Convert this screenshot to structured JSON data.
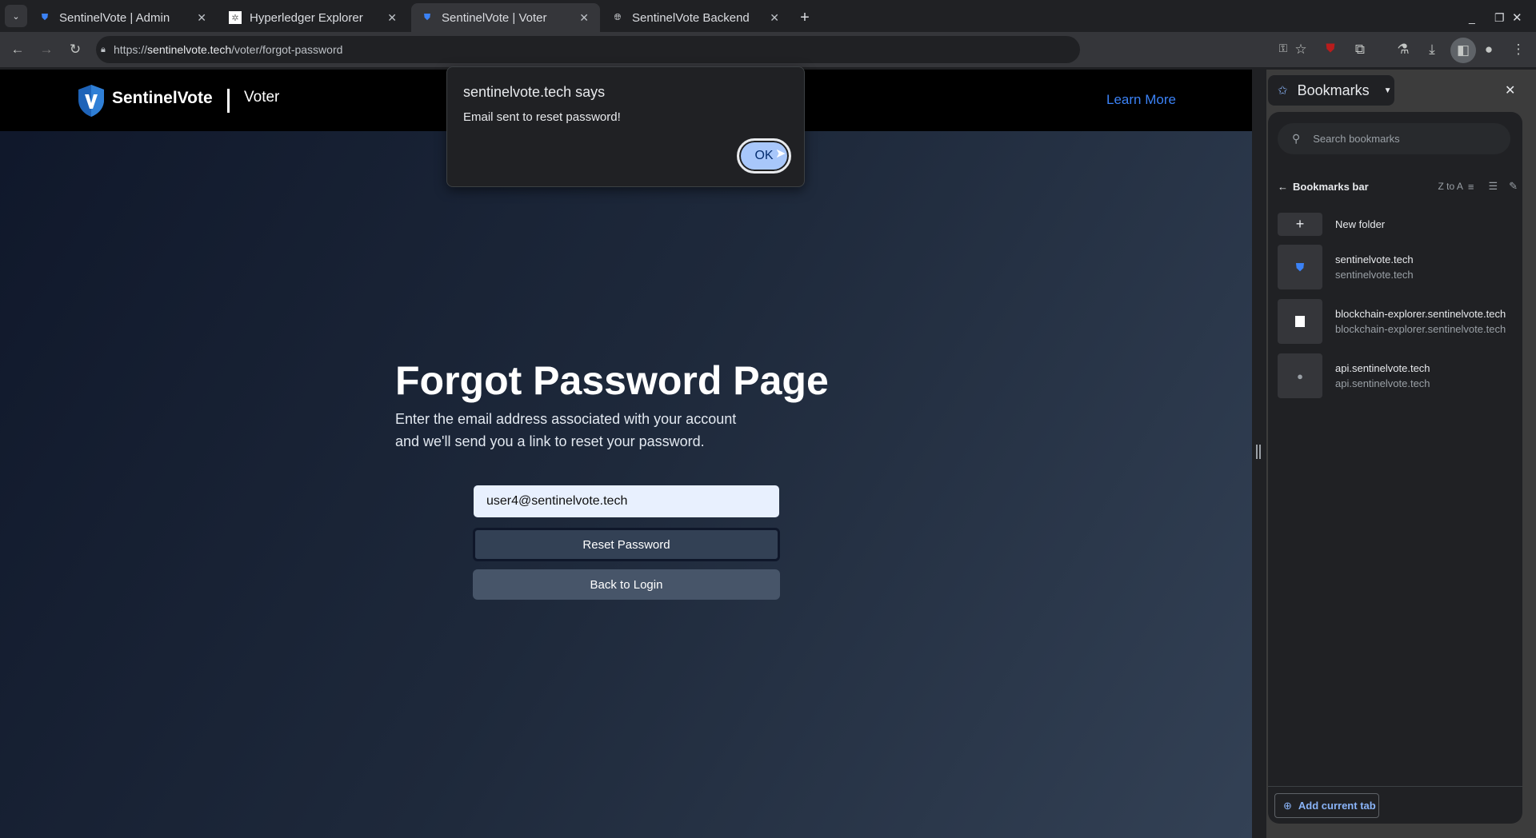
{
  "browser": {
    "tabs": [
      {
        "title": "SentinelVote | Admin",
        "icon": "shield-icon",
        "active": false
      },
      {
        "title": "Hyperledger Explorer",
        "icon": "hyperledger-icon",
        "active": false
      },
      {
        "title": "SentinelVote | Voter",
        "icon": "shield-icon",
        "active": true
      },
      {
        "title": "SentinelVote Backend",
        "icon": "globe-icon",
        "active": false
      }
    ],
    "url_scheme": "https://",
    "url_host": "sentinelvote.tech",
    "url_path": "/voter/forgot-password"
  },
  "header": {
    "brand": "SentinelVote",
    "section": "Voter",
    "learn_more": "Learn More"
  },
  "main": {
    "title": "Forgot Password Page",
    "subtitle_line1": "Enter the email address associated with your account",
    "subtitle_line2": "and we'll send you a link to reset your password.",
    "email_value": "user4@sentinelvote.tech",
    "reset_label": "Reset Password",
    "back_label": "Back to Login"
  },
  "dialog": {
    "title": "sentinelvote.tech says",
    "message": "Email sent to reset password!",
    "ok": "OK"
  },
  "bookmarks": {
    "title": "Bookmarks",
    "search_placeholder": "Search bookmarks",
    "folder": "Bookmarks bar",
    "sort": "Z to A",
    "new_folder": "New folder",
    "items": [
      {
        "title": "sentinelvote.tech",
        "url": "sentinelvote.tech",
        "icon": "shield-icon"
      },
      {
        "title": "blockchain-explorer.sentinelvote.tech",
        "url": "blockchain-explorer.sentinelvote.tech",
        "icon": "hyperledger-icon"
      },
      {
        "title": "api.sentinelvote.tech",
        "url": "api.sentinelvote.tech",
        "icon": "globe-icon"
      }
    ],
    "add_current": "Add current tab"
  },
  "colors": {
    "accent": "#a8c7fa",
    "link": "#3b82f6",
    "brand_shield": "#1e63b8"
  }
}
